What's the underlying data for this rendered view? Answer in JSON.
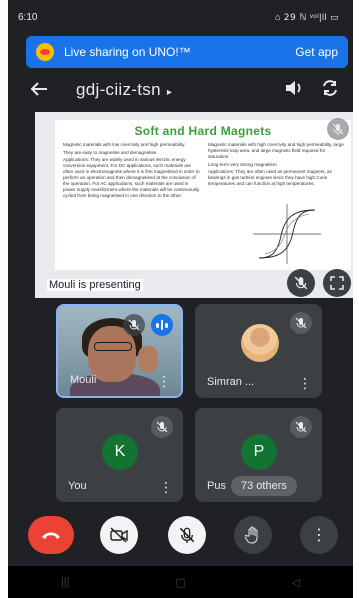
{
  "status_bar": {
    "time": "6:10",
    "indicators": "⌂ 𝟤𝟫 ℕ ᵛᵒˡ|ll ▭"
  },
  "banner": {
    "text": "Live sharing on UNO!™",
    "action": "Get app",
    "color": "#1a73e8"
  },
  "toolbar": {
    "back_icon": "arrow-back-icon",
    "meeting_code": "gdj-ciiz-tsn",
    "chevron": "▸",
    "audio_icon": "speaker-icon",
    "switch_camera_icon": "switch-camera-icon"
  },
  "presentation": {
    "slide_title": "Soft and Hard Magnets",
    "left_col": [
      "Magnetic materials with low coercivity and high permeability.",
      "They are easy to magnetise and demagnetise.",
      "Applications: They are widely used in various electric energy conversion equipment. For DC applications, such materials are often used in electromagnets where it is first magnetised in order to perform an operation and then demagnetised at the conclusion of the operation. For AC applications, such materials are used in power supply transformers where the materials will be continuously cycled from being magnetised in one direction to the other."
    ],
    "right_col": [
      "Magnetic materials with high coercivity and high permeability, large hysteresis loop area, and large magnetic field required for saturation.",
      "Long-term very strong magnetism.",
      "Applications: They are often used as permanent magnets, as bearings in gas turbine engines since they have high Curie temperatures and can function at high temperatures."
    ],
    "presenter_label": "Mouli is presenting"
  },
  "participants": [
    {
      "name": "Mouli",
      "type": "video",
      "speaking": true,
      "muted": true
    },
    {
      "name": "Simran ...",
      "type": "photo",
      "muted": true
    },
    {
      "name": "You",
      "type": "letter",
      "letter": "K",
      "color": "#137333",
      "muted": true
    },
    {
      "name": "Pus",
      "type": "letter",
      "letter": "P",
      "color": "#137333",
      "muted": true,
      "others_count": "73 others"
    }
  ],
  "controls": {
    "end_call": "end-call-icon",
    "camera": "camera-off-icon",
    "mic": "mic-off-icon",
    "raise_hand": "raise-hand-icon",
    "more": "more-options-icon"
  },
  "colors": {
    "background": "#202124",
    "tile": "#3c4043",
    "accent": "#1a73e8",
    "end_call": "#ea4335",
    "avatar_green": "#137333"
  }
}
